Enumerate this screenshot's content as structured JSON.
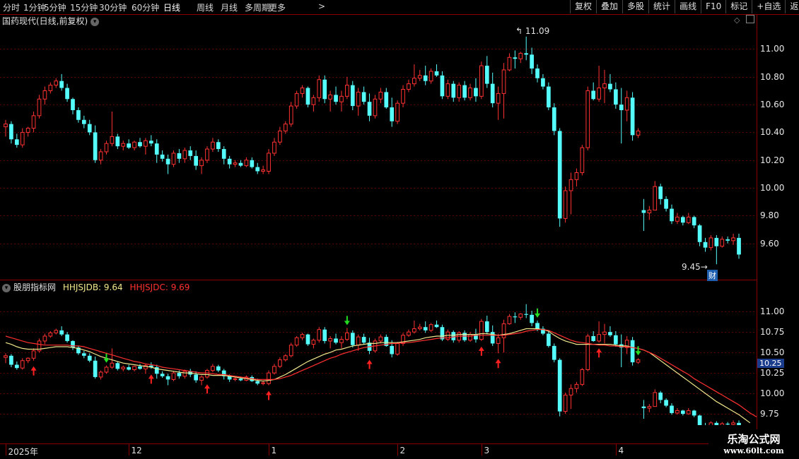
{
  "toolbar": {
    "periods": [
      "分时",
      "1分钟",
      "5分钟",
      "15分钟",
      "30分钟",
      "60分钟",
      "日线",
      "周线",
      "月线",
      "多周期",
      "更多"
    ],
    "active_period": "日线",
    "more_arrow": ">",
    "right_buttons": [
      "复权",
      "叠加",
      "多股",
      "统计",
      "画线",
      "F10",
      "标记",
      "+自选",
      "返回"
    ]
  },
  "main_panel": {
    "title": "国药现代(日线,前复权)",
    "high_annotation": "11.09",
    "low_annotation": "9.45",
    "event_badge": "财"
  },
  "indicator_panel": {
    "title": "股朋指标网",
    "line1_label": "HHJSJDB: 9.64",
    "line2_label": "HHJSJDC: 9.69",
    "current_price": "10.25"
  },
  "time_axis": {
    "labels": [
      {
        "text": "2025年",
        "index": 0
      },
      {
        "text": "12",
        "index": 22
      },
      {
        "text": "1",
        "index": 47
      },
      {
        "text": "2",
        "index": 70
      },
      {
        "text": "3",
        "index": 85
      },
      {
        "text": "4",
        "index": 109
      }
    ]
  },
  "watermark": {
    "line1": "乐淘公式网",
    "line2": "www.60lt.com"
  },
  "colors": {
    "up": "#ff3232",
    "down": "#54fcfc",
    "line1": "#f0e68c",
    "line2": "#ff3030",
    "buy_signal": "#ff2020",
    "sell_signal": "#22dd22",
    "grid": "#5a0000"
  },
  "chart_data": [
    {
      "type": "candlestick",
      "name": "main",
      "ylim": [
        9.38,
        11.15
      ],
      "yticks": [
        9.6,
        9.8,
        10.0,
        10.2,
        10.4,
        10.6,
        10.8,
        11.0
      ],
      "ytick_labels": [
        "9.60",
        "9.80",
        "10.00",
        "10.20",
        "10.40",
        "10.60",
        "10.80",
        "11.00"
      ],
      "ohlc": [
        [
          10.44,
          10.49,
          10.37,
          10.46
        ],
        [
          10.46,
          10.48,
          10.32,
          10.35
        ],
        [
          10.35,
          10.39,
          10.29,
          10.31
        ],
        [
          10.31,
          10.43,
          10.29,
          10.4
        ],
        [
          10.4,
          10.44,
          10.37,
          10.43
        ],
        [
          10.43,
          10.55,
          10.4,
          10.52
        ],
        [
          10.52,
          10.67,
          10.5,
          10.64
        ],
        [
          10.64,
          10.73,
          10.6,
          10.7
        ],
        [
          10.7,
          10.76,
          10.68,
          10.74
        ],
        [
          10.74,
          10.79,
          10.72,
          10.77
        ],
        [
          10.77,
          10.82,
          10.7,
          10.72
        ],
        [
          10.72,
          10.75,
          10.62,
          10.64
        ],
        [
          10.64,
          10.65,
          10.53,
          10.56
        ],
        [
          10.56,
          10.58,
          10.47,
          10.49
        ],
        [
          10.49,
          10.52,
          10.43,
          10.46
        ],
        [
          10.46,
          10.49,
          10.38,
          10.4
        ],
        [
          10.4,
          10.45,
          10.18,
          10.2
        ],
        [
          10.2,
          10.28,
          10.17,
          10.26
        ],
        [
          10.26,
          10.34,
          10.24,
          10.32
        ],
        [
          10.32,
          10.55,
          10.3,
          10.37
        ],
        [
          10.37,
          10.39,
          10.28,
          10.3
        ],
        [
          10.3,
          10.34,
          10.27,
          10.32
        ],
        [
          10.32,
          10.35,
          10.28,
          10.29
        ],
        [
          10.29,
          10.34,
          10.27,
          10.33
        ],
        [
          10.33,
          10.36,
          10.29,
          10.3
        ],
        [
          10.3,
          10.36,
          10.24,
          10.34
        ],
        [
          10.34,
          10.38,
          10.3,
          10.32
        ],
        [
          10.32,
          10.35,
          10.18,
          10.24
        ],
        [
          10.24,
          10.27,
          10.19,
          10.21
        ],
        [
          10.21,
          10.24,
          10.1,
          10.17
        ],
        [
          10.17,
          10.27,
          10.15,
          10.25
        ],
        [
          10.25,
          10.28,
          10.18,
          10.21
        ],
        [
          10.21,
          10.29,
          10.18,
          10.27
        ],
        [
          10.27,
          10.3,
          10.2,
          10.23
        ],
        [
          10.23,
          10.27,
          10.13,
          10.16
        ],
        [
          10.16,
          10.22,
          10.1,
          10.2
        ],
        [
          10.2,
          10.3,
          10.18,
          10.28
        ],
        [
          10.28,
          10.36,
          10.26,
          10.33
        ],
        [
          10.33,
          10.35,
          10.26,
          10.28
        ],
        [
          10.28,
          10.3,
          10.17,
          10.21
        ],
        [
          10.21,
          10.23,
          10.14,
          10.17
        ],
        [
          10.17,
          10.2,
          10.15,
          10.18
        ],
        [
          10.18,
          10.2,
          10.15,
          10.16
        ],
        [
          10.16,
          10.22,
          10.15,
          10.2
        ],
        [
          10.2,
          10.22,
          10.14,
          10.15
        ],
        [
          10.15,
          10.18,
          10.1,
          10.12
        ],
        [
          10.12,
          10.16,
          10.1,
          10.13
        ],
        [
          10.12,
          10.28,
          10.1,
          10.25
        ],
        [
          10.25,
          10.36,
          10.23,
          10.33
        ],
        [
          10.33,
          10.44,
          10.31,
          10.41
        ],
        [
          10.41,
          10.48,
          10.39,
          10.46
        ],
        [
          10.46,
          10.62,
          10.44,
          10.59
        ],
        [
          10.59,
          10.7,
          10.57,
          10.68
        ],
        [
          10.68,
          10.74,
          10.65,
          10.72
        ],
        [
          10.72,
          10.73,
          10.58,
          10.6
        ],
        [
          10.6,
          10.67,
          10.55,
          10.65
        ],
        [
          10.65,
          10.81,
          10.62,
          10.78
        ],
        [
          10.78,
          10.81,
          10.61,
          10.64
        ],
        [
          10.64,
          10.7,
          10.55,
          10.67
        ],
        [
          10.67,
          10.73,
          10.6,
          10.62
        ],
        [
          10.62,
          10.7,
          10.55,
          10.66
        ],
        [
          10.66,
          10.8,
          10.64,
          10.74
        ],
        [
          10.74,
          10.77,
          10.56,
          10.59
        ],
        [
          10.59,
          10.72,
          10.52,
          10.69
        ],
        [
          10.69,
          10.73,
          10.6,
          10.62
        ],
        [
          10.62,
          10.68,
          10.48,
          10.52
        ],
        [
          10.52,
          10.67,
          10.5,
          10.64
        ],
        [
          10.64,
          10.72,
          10.61,
          10.69
        ],
        [
          10.69,
          10.72,
          10.57,
          10.58
        ],
        [
          10.58,
          10.65,
          10.44,
          10.48
        ],
        [
          10.48,
          10.63,
          10.46,
          10.61
        ],
        [
          10.61,
          10.74,
          10.58,
          10.71
        ],
        [
          10.71,
          10.78,
          10.69,
          10.75
        ],
        [
          10.75,
          10.89,
          10.73,
          10.79
        ],
        [
          10.79,
          10.85,
          10.77,
          10.81
        ],
        [
          10.81,
          10.88,
          10.74,
          10.77
        ],
        [
          10.77,
          10.86,
          10.75,
          10.84
        ],
        [
          10.84,
          10.89,
          10.8,
          10.81
        ],
        [
          10.81,
          10.84,
          10.64,
          10.66
        ],
        [
          10.66,
          10.78,
          10.64,
          10.75
        ],
        [
          10.75,
          10.77,
          10.62,
          10.65
        ],
        [
          10.65,
          10.76,
          10.62,
          10.74
        ],
        [
          10.74,
          10.77,
          10.63,
          10.65
        ],
        [
          10.65,
          10.75,
          10.63,
          10.72
        ],
        [
          10.72,
          10.79,
          10.62,
          10.66
        ],
        [
          10.66,
          10.91,
          10.64,
          10.88
        ],
        [
          10.88,
          10.95,
          10.72,
          10.75
        ],
        [
          10.75,
          10.83,
          10.58,
          10.61
        ],
        [
          10.61,
          10.73,
          10.49,
          10.68
        ],
        [
          10.68,
          10.9,
          10.5,
          10.85
        ],
        [
          10.85,
          10.97,
          10.84,
          10.94
        ],
        [
          10.94,
          10.99,
          10.86,
          10.93
        ],
        [
          10.93,
          10.98,
          10.9,
          10.97
        ],
        [
          10.97,
          11.09,
          10.92,
          10.96
        ],
        [
          10.96,
          11.01,
          10.82,
          10.86
        ],
        [
          10.86,
          10.89,
          10.76,
          10.79
        ],
        [
          10.79,
          10.82,
          10.71,
          10.73
        ],
        [
          10.73,
          10.76,
          10.56,
          10.58
        ],
        [
          10.58,
          10.61,
          10.38,
          10.41
        ],
        [
          10.41,
          10.43,
          9.72,
          9.78
        ],
        [
          9.78,
          10.01,
          9.75,
          9.98
        ],
        [
          9.98,
          10.11,
          9.81,
          10.06
        ],
        [
          10.06,
          10.14,
          10.01,
          10.11
        ],
        [
          10.11,
          10.31,
          10.09,
          10.29
        ],
        [
          10.29,
          10.73,
          10.27,
          10.7
        ],
        [
          10.7,
          10.76,
          10.63,
          10.64
        ],
        [
          10.64,
          10.88,
          10.62,
          10.72
        ],
        [
          10.72,
          10.85,
          10.61,
          10.75
        ],
        [
          10.75,
          10.82,
          10.69,
          10.71
        ],
        [
          10.71,
          10.76,
          10.57,
          10.6
        ],
        [
          10.6,
          10.72,
          10.32,
          10.56
        ],
        [
          10.56,
          10.7,
          10.48,
          10.65
        ],
        [
          10.65,
          10.69,
          10.34,
          10.38
        ],
        [
          10.38,
          10.43,
          10.36,
          10.41
        ],
        [
          9.84,
          9.92,
          9.69,
          9.82
        ],
        [
          9.82,
          9.87,
          9.77,
          9.84
        ],
        [
          9.84,
          10.05,
          9.84,
          10.01
        ],
        [
          10.01,
          10.03,
          9.88,
          9.92
        ],
        [
          9.92,
          9.94,
          9.83,
          9.85
        ],
        [
          9.85,
          9.88,
          9.74,
          9.76
        ],
        [
          9.76,
          9.82,
          9.74,
          9.79
        ],
        [
          9.79,
          9.8,
          9.73,
          9.75
        ],
        [
          9.75,
          9.82,
          9.74,
          9.79
        ],
        [
          9.79,
          9.8,
          9.71,
          9.73
        ],
        [
          9.73,
          9.74,
          9.58,
          9.61
        ],
        [
          9.61,
          9.64,
          9.54,
          9.57
        ],
        [
          9.57,
          9.66,
          9.55,
          9.64
        ],
        [
          9.64,
          9.66,
          9.45,
          9.58
        ],
        [
          9.58,
          9.65,
          9.57,
          9.63
        ],
        [
          9.63,
          9.65,
          9.6,
          9.62
        ],
        [
          9.62,
          9.67,
          9.59,
          9.64
        ],
        [
          9.64,
          9.67,
          9.49,
          9.52
        ]
      ]
    },
    {
      "type": "line",
      "name": "indicator",
      "ylim": [
        9.63,
        11.2
      ],
      "yticks": [
        9.75,
        10.0,
        10.25,
        10.5,
        10.75,
        11.0
      ],
      "ytick_labels": [
        "9.75",
        "10.00",
        "10.25",
        "10.50",
        "10.75",
        "11.00"
      ],
      "series": [
        {
          "name": "HHJSJDB",
          "color": "#f0e68c",
          "values": [
            10.62,
            10.6,
            10.57,
            10.55,
            10.54,
            10.54,
            10.54,
            10.55,
            10.56,
            10.57,
            10.57,
            10.57,
            10.56,
            10.55,
            10.53,
            10.51,
            10.48,
            10.45,
            10.43,
            10.41,
            10.39,
            10.37,
            10.36,
            10.35,
            10.34,
            10.33,
            10.32,
            10.3,
            10.29,
            10.28,
            10.27,
            10.26,
            10.25,
            10.25,
            10.24,
            10.23,
            10.23,
            10.22,
            10.22,
            10.22,
            10.21,
            10.2,
            10.19,
            10.18,
            10.17,
            10.16,
            10.15,
            10.16,
            10.17,
            10.2,
            10.23,
            10.27,
            10.31,
            10.35,
            10.39,
            10.42,
            10.45,
            10.48,
            10.5,
            10.53,
            10.54,
            10.56,
            10.58,
            10.59,
            10.6,
            10.61,
            10.61,
            10.62,
            10.62,
            10.62,
            10.62,
            10.63,
            10.64,
            10.65,
            10.66,
            10.68,
            10.69,
            10.7,
            10.7,
            10.71,
            10.71,
            10.72,
            10.72,
            10.72,
            10.72,
            10.73,
            10.73,
            10.72,
            10.71,
            10.72,
            10.73,
            10.75,
            10.77,
            10.79,
            10.79,
            10.79,
            10.78,
            10.76,
            10.71,
            10.67,
            10.64,
            10.62,
            10.6,
            10.6,
            10.6,
            10.6,
            10.6,
            10.6,
            10.6,
            10.59,
            10.58,
            10.58,
            10.56,
            10.55,
            10.53,
            10.5,
            10.45,
            10.4,
            10.35,
            10.3,
            10.25,
            10.2,
            10.15,
            10.1,
            10.05,
            10.0,
            9.95,
            9.9,
            9.86,
            9.82,
            9.78,
            9.74,
            9.69,
            9.64
          ]
        },
        {
          "name": "HHJSJDC",
          "color": "#ff3030",
          "values": [
            10.7,
            10.68,
            10.66,
            10.64,
            10.62,
            10.61,
            10.6,
            10.59,
            10.59,
            10.59,
            10.59,
            10.59,
            10.58,
            10.58,
            10.57,
            10.55,
            10.53,
            10.51,
            10.49,
            10.47,
            10.45,
            10.43,
            10.41,
            10.39,
            10.38,
            10.36,
            10.35,
            10.34,
            10.32,
            10.31,
            10.3,
            10.29,
            10.28,
            10.27,
            10.26,
            10.25,
            10.25,
            10.24,
            10.23,
            10.23,
            10.22,
            10.21,
            10.2,
            10.19,
            10.18,
            10.17,
            10.17,
            10.17,
            10.17,
            10.18,
            10.2,
            10.22,
            10.25,
            10.28,
            10.31,
            10.34,
            10.37,
            10.4,
            10.43,
            10.45,
            10.48,
            10.5,
            10.52,
            10.54,
            10.56,
            10.57,
            10.58,
            10.59,
            10.6,
            10.61,
            10.61,
            10.62,
            10.62,
            10.63,
            10.64,
            10.65,
            10.66,
            10.67,
            10.68,
            10.68,
            10.69,
            10.7,
            10.7,
            10.7,
            10.71,
            10.71,
            10.71,
            10.71,
            10.71,
            10.71,
            10.72,
            10.73,
            10.74,
            10.76,
            10.77,
            10.78,
            10.78,
            10.77,
            10.74,
            10.71,
            10.68,
            10.65,
            10.63,
            10.62,
            10.61,
            10.6,
            10.59,
            10.59,
            10.58,
            10.58,
            10.57,
            10.57,
            10.56,
            10.55,
            10.53,
            10.5,
            10.47,
            10.43,
            10.39,
            10.35,
            10.31,
            10.27,
            10.23,
            10.18,
            10.14,
            10.1,
            10.06,
            10.02,
            9.98,
            9.94,
            9.9,
            9.86,
            9.81,
            9.76,
            9.72,
            9.69
          ]
        }
      ],
      "buy_signals": [
        5,
        26,
        36,
        47,
        65,
        85,
        88,
        106
      ],
      "sell_signals": [
        18,
        61,
        95,
        113
      ]
    }
  ]
}
